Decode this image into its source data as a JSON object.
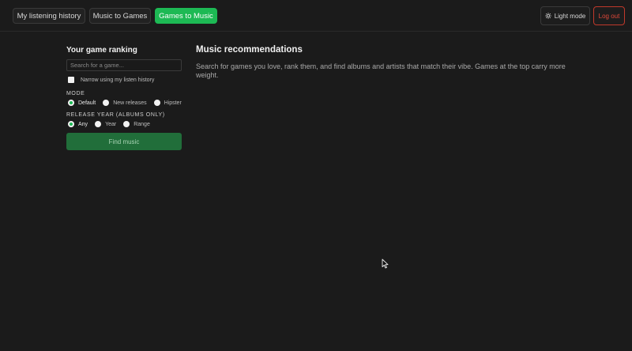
{
  "nav": {
    "tabs": [
      {
        "label": "My listening history",
        "active": false
      },
      {
        "label": "Music to Games",
        "active": false
      },
      {
        "label": "Games to Music",
        "active": true
      }
    ],
    "light_mode": "Light mode",
    "logout": "Log out"
  },
  "sidebar": {
    "title": "Your game ranking",
    "search_placeholder": "Search for a game...",
    "narrow_label": "Narrow using my listen history",
    "mode": {
      "label": "MODE",
      "options": [
        "Default",
        "New releases",
        "Hipster"
      ],
      "selected": "Default"
    },
    "release_year": {
      "label": "RELEASE YEAR (ALBUMS ONLY)",
      "options": [
        "Any",
        "Year",
        "Range"
      ],
      "selected": "Any"
    },
    "find_button": "Find music"
  },
  "main": {
    "title": "Music recommendations",
    "description": "Search for games you love, rank them, and find albums and artists that match their vibe. Games at the top carry more weight."
  },
  "colors": {
    "accent": "#1db954",
    "danger": "#e0483a",
    "background": "#1b1b1b"
  },
  "icons": {
    "light_mode": "sun-icon",
    "cursor": "mouse-pointer-icon"
  }
}
